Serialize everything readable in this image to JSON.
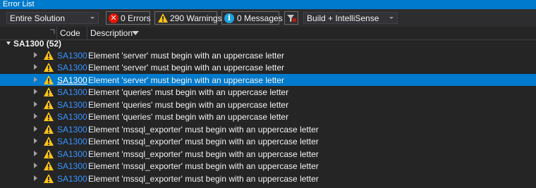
{
  "window": {
    "title": "Error List"
  },
  "toolbar": {
    "scope": "Entire Solution",
    "errors_label": "0 Errors",
    "warnings_label": "290 Warnings",
    "messages_label": "0 Messages",
    "build_filter": "Build + IntelliSense"
  },
  "columns": {
    "code": "Code",
    "description": "Description"
  },
  "group": {
    "label": "SA1300  (52)"
  },
  "rows": [
    {
      "code": "SA1300",
      "description": "Element 'server' must begin with an uppercase letter"
    },
    {
      "code": "SA1300",
      "description": "Element 'server' must begin with an uppercase letter"
    },
    {
      "code": "SA1300",
      "description": "Element 'server' must begin with an uppercase letter",
      "selected": true
    },
    {
      "code": "SA1300",
      "description": "Element 'queries' must begin with an uppercase letter"
    },
    {
      "code": "SA1300",
      "description": "Element 'queries' must begin with an uppercase letter"
    },
    {
      "code": "SA1300",
      "description": "Element 'queries' must begin with an uppercase letter"
    },
    {
      "code": "SA1300",
      "description": "Element 'mssql_exporter' must begin with an uppercase letter"
    },
    {
      "code": "SA1300",
      "description": "Element 'mssql_exporter' must begin with an uppercase letter"
    },
    {
      "code": "SA1300",
      "description": "Element 'mssql_exporter' must begin with an uppercase letter"
    },
    {
      "code": "SA1300",
      "description": "Element 'mssql_exporter' must begin with an uppercase letter"
    },
    {
      "code": "SA1300",
      "description": "Element 'mssql_exporter' must begin with an uppercase letter"
    }
  ],
  "colors": {
    "accent": "#007acc",
    "background": "#252526",
    "toolbar": "#2d2d30",
    "code_link": "#3794ff",
    "warning": "#fcc419",
    "error": "#e51400",
    "info": "#1ba1e2"
  }
}
